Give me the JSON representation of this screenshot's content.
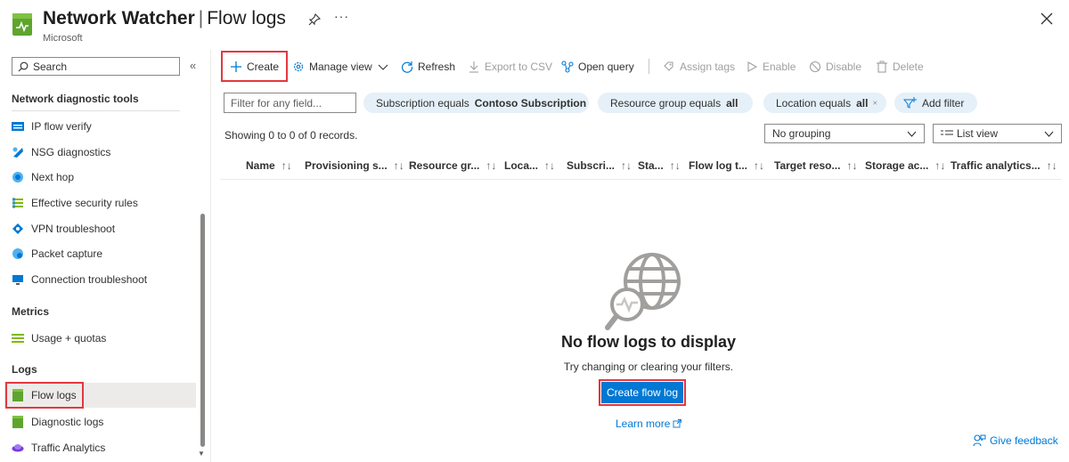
{
  "header": {
    "title": "Network Watcher",
    "separator": "|",
    "page": "Flow logs",
    "subtitle": "Microsoft"
  },
  "sidebar": {
    "search_placeholder": "Search",
    "sections": [
      {
        "title": "Network diagnostic tools",
        "items": [
          {
            "label": "IP flow verify",
            "icon": "ip-flow-icon"
          },
          {
            "label": "NSG diagnostics",
            "icon": "nsg-icon"
          },
          {
            "label": "Next hop",
            "icon": "next-hop-icon"
          },
          {
            "label": "Effective security rules",
            "icon": "security-rules-icon"
          },
          {
            "label": "VPN troubleshoot",
            "icon": "vpn-icon"
          },
          {
            "label": "Packet capture",
            "icon": "packet-capture-icon"
          },
          {
            "label": "Connection troubleshoot",
            "icon": "monitor-icon"
          }
        ]
      },
      {
        "title": "Metrics",
        "items": [
          {
            "label": "Usage + quotas",
            "icon": "usage-icon"
          }
        ]
      },
      {
        "title": "Logs",
        "items": [
          {
            "label": "Flow logs",
            "icon": "flow-logs-icon",
            "active": true
          },
          {
            "label": "Diagnostic logs",
            "icon": "diagnostic-logs-icon"
          },
          {
            "label": "Traffic Analytics",
            "icon": "traffic-analytics-icon"
          }
        ]
      }
    ]
  },
  "toolbar": {
    "create": "Create",
    "manage_view": "Manage view",
    "refresh": "Refresh",
    "export_csv": "Export to CSV",
    "open_query": "Open query",
    "assign_tags": "Assign tags",
    "enable": "Enable",
    "disable": "Disable",
    "delete": "Delete"
  },
  "filters": {
    "input_placeholder": "Filter for any field...",
    "subscription_prefix": "Subscription equals",
    "subscription_value": "Contoso Subscription",
    "resource_group_prefix": "Resource group equals",
    "resource_group_value": "all",
    "location_prefix": "Location equals",
    "location_value": "all",
    "add_filter": "Add filter"
  },
  "records_text": "Showing 0 to 0 of 0 records.",
  "grouping": "No grouping",
  "view": "List view",
  "columns": [
    "Name",
    "Provisioning s...",
    "Resource gr...",
    "Loca...",
    "Subscri...",
    "Sta...",
    "Flow log t...",
    "Target reso...",
    "Storage ac...",
    "Traffic analytics..."
  ],
  "empty_state": {
    "title": "No flow logs to display",
    "subtitle": "Try changing or clearing your filters.",
    "button": "Create flow log",
    "learn_more": "Learn more"
  },
  "feedback": "Give feedback",
  "colors": {
    "accent": "#0078d4",
    "highlight_box": "#e3383f",
    "pill_bg": "#e5f0f9",
    "active_item_bg": "#edebe9"
  }
}
